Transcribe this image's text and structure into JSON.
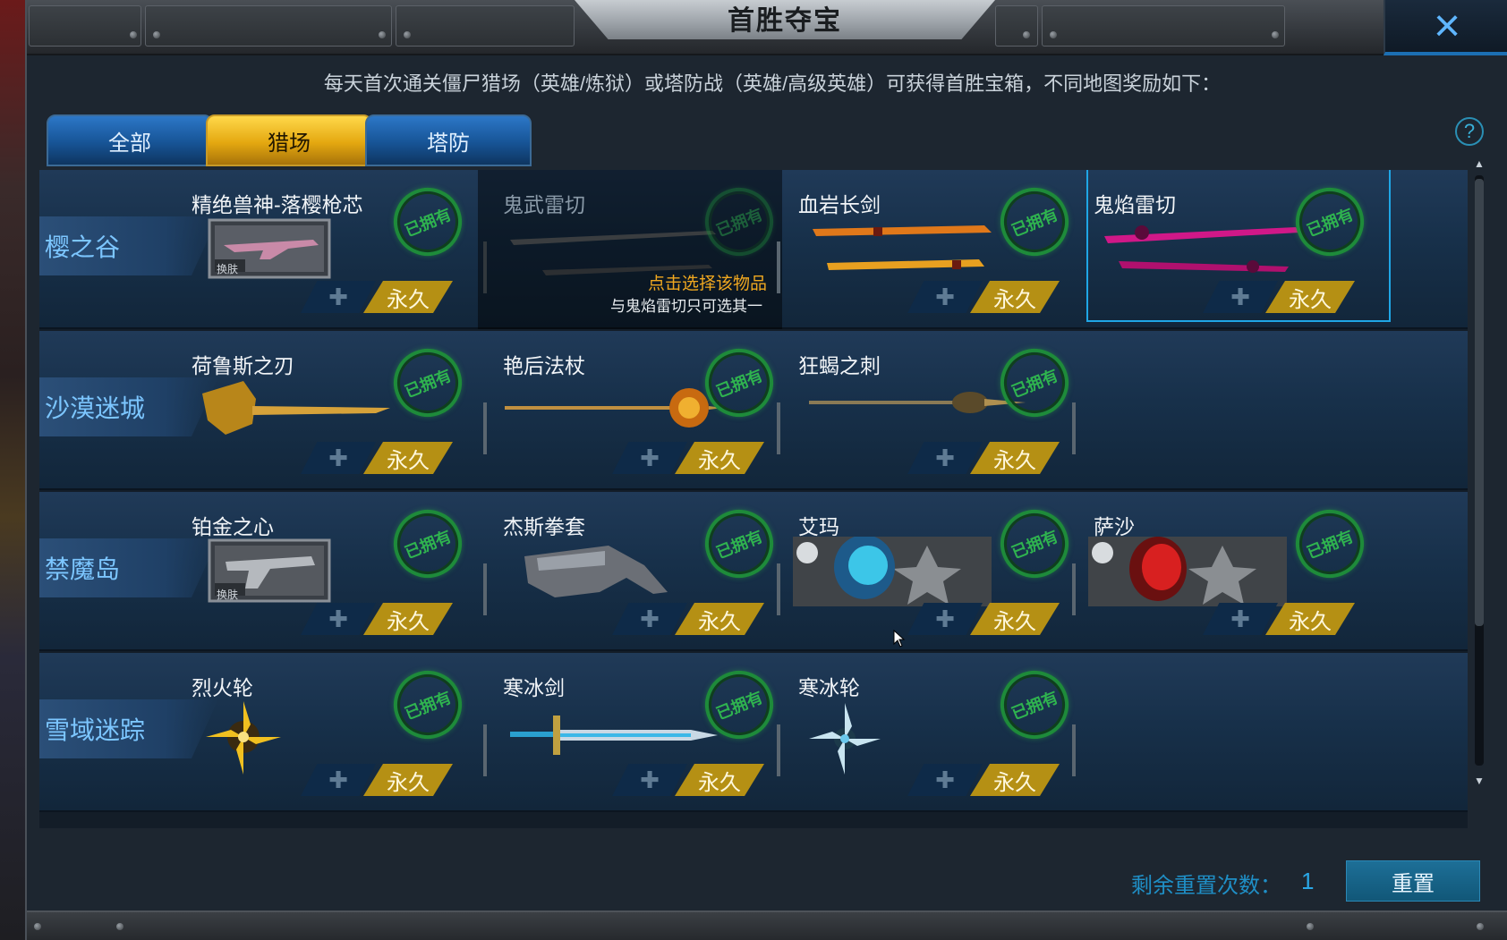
{
  "window": {
    "title": "首胜夺宝",
    "close_icon": "×"
  },
  "description": "每天首次通关僵尸猎场（英雄/炼狱）或塔防战（英雄/高级英雄）可获得首胜宝箱，不同地图奖励如下：",
  "tabs": [
    {
      "label": "全部",
      "active": false
    },
    {
      "label": "猎场",
      "active": true
    },
    {
      "label": "塔防",
      "active": false
    }
  ],
  "help_icon": "?",
  "owned_stamp": "已拥有",
  "permanent_label": "永久",
  "rows": [
    {
      "map": "樱之谷",
      "items": [
        {
          "name": "精绝兽神-落樱枪芯",
          "tag": "换肤"
        },
        {
          "name": "鬼武雷切",
          "select_hint": "点击选择该物品",
          "select_note": "与鬼焰雷切只可选其一"
        },
        {
          "name": "血岩长剑"
        },
        {
          "name": "鬼焰雷切"
        }
      ]
    },
    {
      "map": "沙漠迷城",
      "items": [
        {
          "name": "荷鲁斯之刃"
        },
        {
          "name": "艳后法杖"
        },
        {
          "name": "狂蝎之刺"
        }
      ]
    },
    {
      "map": "禁魔岛",
      "items": [
        {
          "name": "铂金之心",
          "tag": "换肤"
        },
        {
          "name": "杰斯拳套"
        },
        {
          "name": "艾玛"
        },
        {
          "name": "萨沙"
        }
      ]
    },
    {
      "map": "雪域迷踪",
      "items": [
        {
          "name": "烈火轮"
        },
        {
          "name": "寒冰剑"
        },
        {
          "name": "寒冰轮"
        }
      ]
    }
  ],
  "footer": {
    "reset_label": "剩余重置次数：",
    "reset_count": "1",
    "reset_button": "重置"
  },
  "colors": {
    "accent_blue": "#1fa6e6",
    "gold": "#b59014",
    "owned_green": "#1e8b3a",
    "map_label": "#7cc6ff"
  }
}
